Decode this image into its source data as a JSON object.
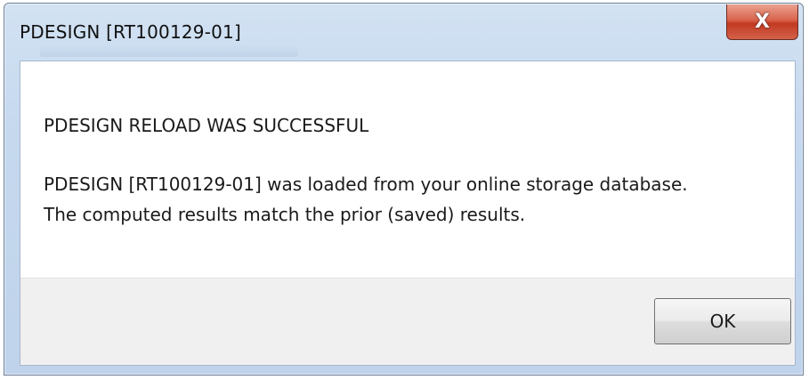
{
  "window": {
    "title": "PDESIGN [RT100129-01]",
    "close_icon": "close-icon",
    "close_glyph": "X"
  },
  "message": {
    "heading": "PDESIGN RELOAD WAS SUCCESSFUL",
    "line1": "PDESIGN [RT100129-01] was loaded from your online storage database.",
    "line2": "The computed results match the prior (saved) results."
  },
  "buttons": {
    "ok_label": "OK"
  },
  "colors": {
    "titlebar": "#c5d8ee",
    "close_button": "#c9452b",
    "footer": "#f0f0f0"
  }
}
